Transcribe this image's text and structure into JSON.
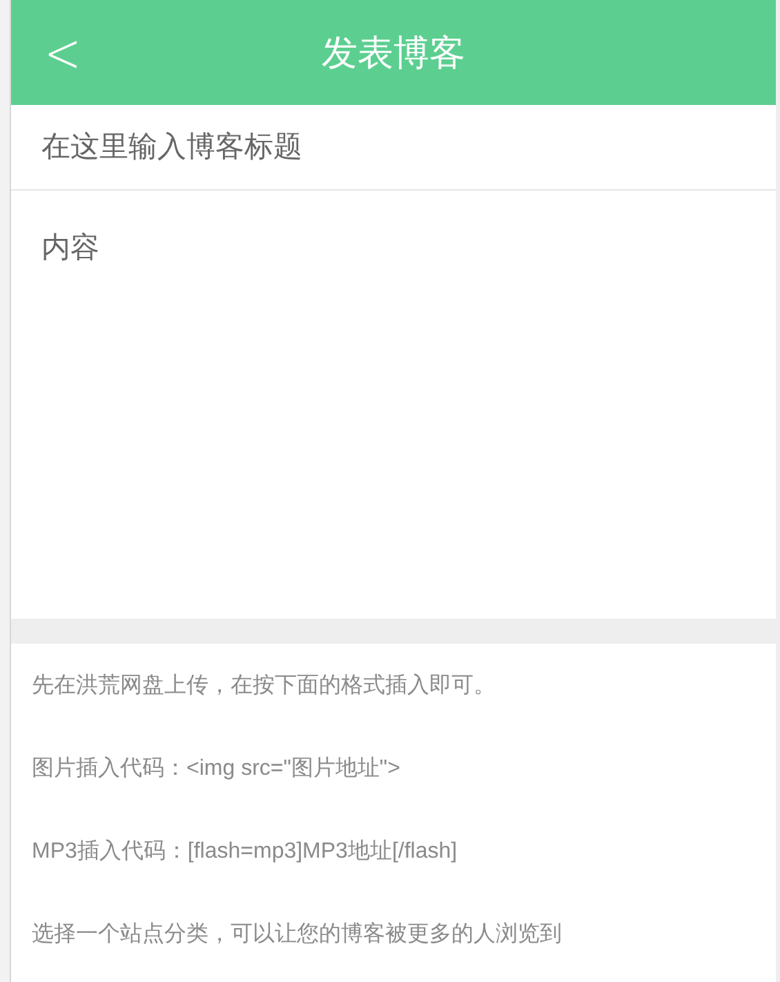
{
  "header": {
    "back": "<",
    "title": "发表博客"
  },
  "form": {
    "title_placeholder": "在这里输入博客标题",
    "content_placeholder": "内容"
  },
  "hints": [
    "先在洪荒网盘上传，在按下面的格式插入即可。",
    "图片插入代码：<img src=\"图片地址\">",
    "MP3插入代码：[flash=mp3]MP3地址[/flash]",
    "选择一个站点分类，可以让您的博客被更多的人浏览到"
  ]
}
